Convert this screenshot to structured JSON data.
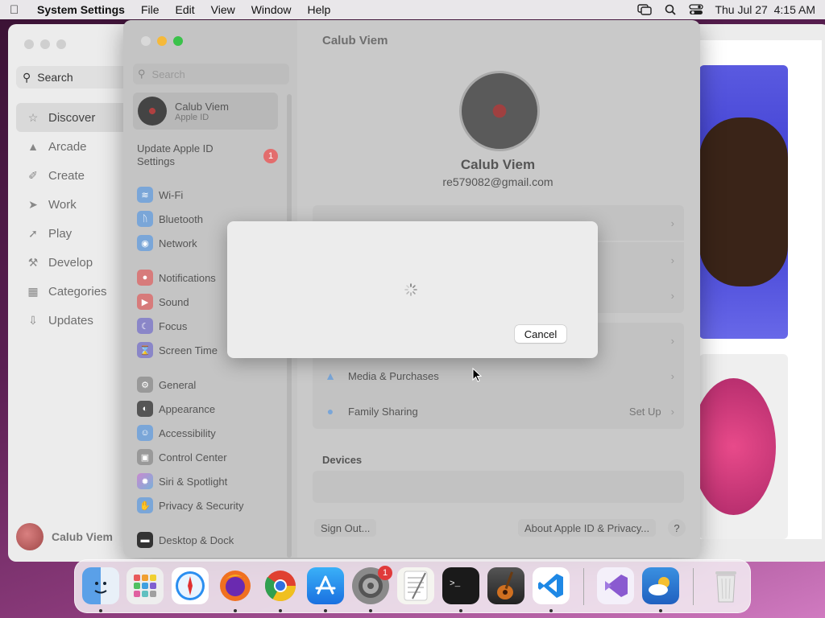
{
  "menubar": {
    "app_name": "System Settings",
    "menus": [
      "File",
      "Edit",
      "View",
      "Window",
      "Help"
    ],
    "datetime": "Thu Jul 27  4:15 AM"
  },
  "appstore": {
    "search_label": "Search",
    "nav": [
      "Discover",
      "Arcade",
      "Create",
      "Work",
      "Play",
      "Develop",
      "Categories",
      "Updates"
    ],
    "user_name": "Calub Viem"
  },
  "settings": {
    "search_placeholder": "Search",
    "account_name": "Calub Viem",
    "account_sub": "Apple ID",
    "update_text": "Update Apple ID Settings",
    "update_badge": "1",
    "sidebar_items": [
      {
        "label": "Wi-Fi",
        "icon": "wifi-icon"
      },
      {
        "label": "Bluetooth",
        "icon": "bluetooth-icon"
      },
      {
        "label": "Network",
        "icon": "globe-icon"
      },
      {
        "label": "Notifications",
        "icon": "bell-icon"
      },
      {
        "label": "Sound",
        "icon": "speaker-icon"
      },
      {
        "label": "Focus",
        "icon": "moon-icon"
      },
      {
        "label": "Screen Time",
        "icon": "hourglass-icon"
      },
      {
        "label": "General",
        "icon": "gear-icon"
      },
      {
        "label": "Appearance",
        "icon": "appearance-icon"
      },
      {
        "label": "Accessibility",
        "icon": "accessibility-icon"
      },
      {
        "label": "Control Center",
        "icon": "control-center-icon"
      },
      {
        "label": "Siri & Spotlight",
        "icon": "siri-icon"
      },
      {
        "label": "Privacy & Security",
        "icon": "hand-icon"
      },
      {
        "label": "Desktop & Dock",
        "icon": "dock-icon"
      }
    ],
    "title": "Calub Viem",
    "profile_name": "Calub Viem",
    "profile_email": "re579082@gmail.com",
    "rows": [
      {
        "label": "Media & Purchases",
        "value": ""
      },
      {
        "label": "Family Sharing",
        "value": "Set Up"
      }
    ],
    "devices_label": "Devices",
    "signout_label": "Sign Out...",
    "about_label": "About Apple ID & Privacy...",
    "help_label": "?"
  },
  "sheet": {
    "cancel_label": "Cancel"
  },
  "dock": {
    "badge": "1"
  }
}
